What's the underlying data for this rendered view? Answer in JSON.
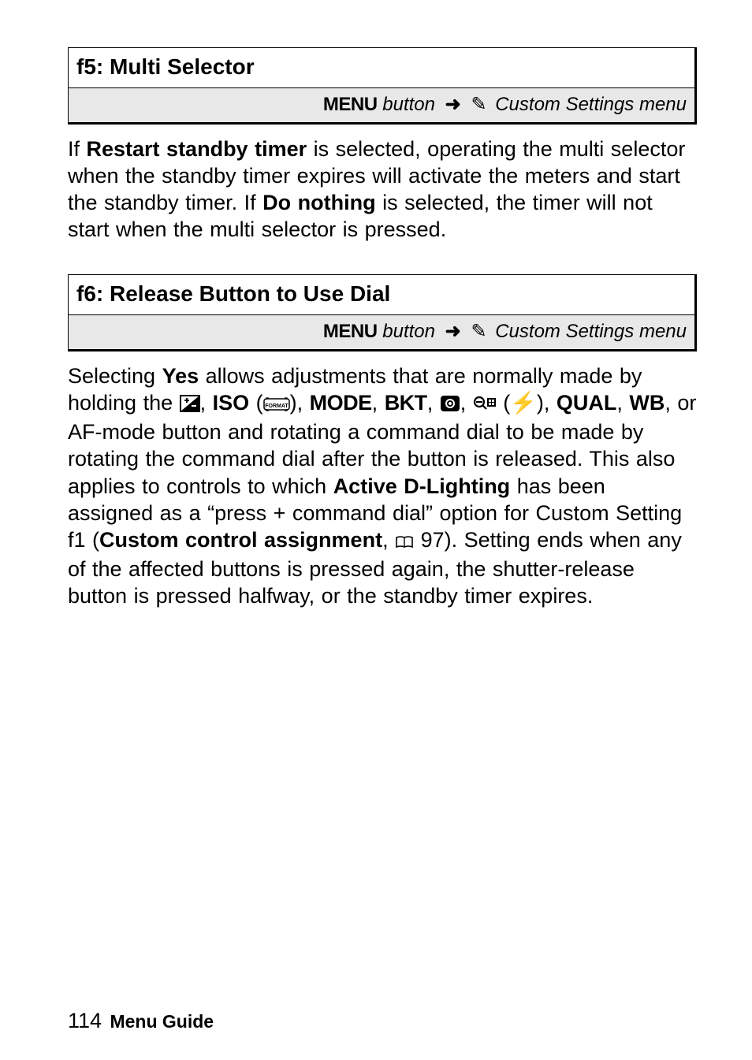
{
  "sections": [
    {
      "title": "f5: Multi Selector",
      "breadcrumb": {
        "menu_button": "MENU",
        "button_word": "button",
        "arrow": "➜",
        "pencil": "✎",
        "menu_name": "Custom Settings menu"
      }
    },
    {
      "title": "f6: Release Button to Use Dial",
      "breadcrumb": {
        "menu_button": "MENU",
        "button_word": "button",
        "arrow": "➜",
        "pencil": "✎",
        "menu_name": "Custom Settings menu"
      }
    }
  ],
  "p1": {
    "t1": "If ",
    "b1": "Restart standby timer",
    "t2": " is selected, operating the multi selector when the standby timer expires will activate the meters and start the standby timer.  If ",
    "b2": "Do nothing",
    "t3": " is selected, the timer will not start when the multi selector is pressed."
  },
  "p2": {
    "t1": "Selecting ",
    "b1": "Yes",
    "t2": " allows adjustments that are normally made by holding the ",
    "iso": "ISO",
    "paren_open": " (",
    "paren_close": ")",
    "comma": ", ",
    "mode": "MODE",
    "bkt": "BKT",
    "flash_glyph": "⚡",
    "qual": "QUAL",
    "wb": "WB",
    "t3": ", or AF-mode button and rotating a command dial to be made by rotating the command dial after the button is released.  This also applies to controls to which ",
    "b2": "Active D-Lighting",
    "t4": " has been assigned as a “press + command dial” option for Custom Setting f1 (",
    "b3": "Custom control assignment",
    "t5": ", ",
    "pgref": "97",
    "t6": ").  Setting ends when any of the affected buttons is pressed again, the shutter-release button is pressed halfway, or the standby timer expires."
  },
  "footer": {
    "page_number": "114",
    "label": "Menu Guide"
  }
}
